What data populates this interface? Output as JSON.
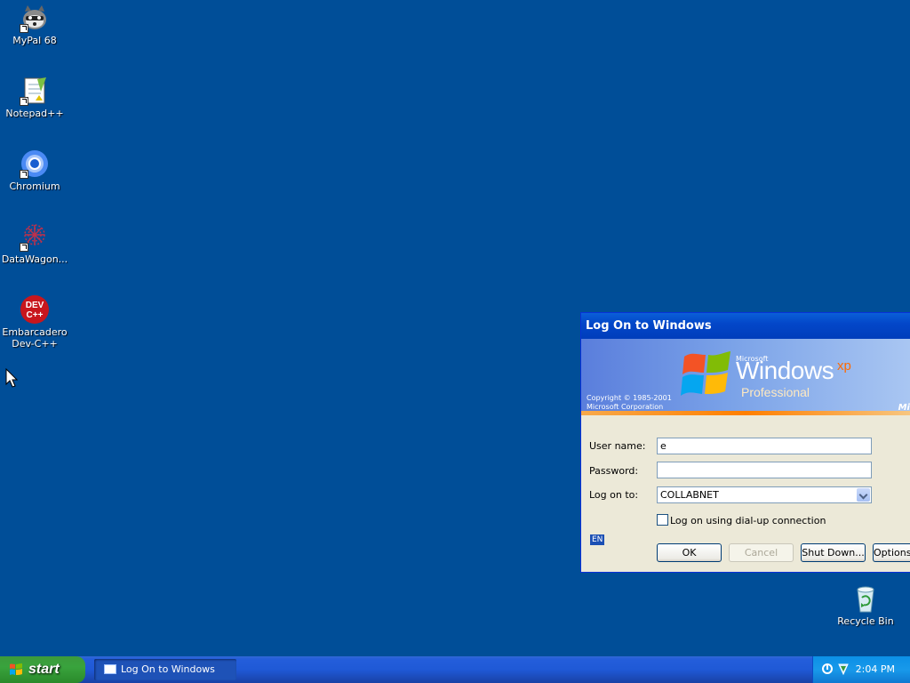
{
  "desktop": {
    "icons": [
      {
        "label": "MyPal 68",
        "icon": "raccoon-icon"
      },
      {
        "label": "Notepad++",
        "icon": "notepad-icon"
      },
      {
        "label": "Chromium",
        "icon": "chromium-icon"
      },
      {
        "label": "DataWagon...",
        "icon": "datawagon-icon"
      },
      {
        "label": "Embarcadero Dev-C++",
        "icon": "devcpp-icon"
      }
    ],
    "recycle_bin": "Recycle Bin"
  },
  "dialog": {
    "title": "Log On to Windows",
    "banner": {
      "copyright_line1": "Copyright © 1985-2001",
      "copyright_line2": "Microsoft Corporation",
      "microsoft": "Microsoft",
      "windows": "Windows",
      "xp": "xp",
      "edition": "Professional",
      "corner": "Mi"
    },
    "username_label": "User name:",
    "username_value": "e",
    "password_label": "Password:",
    "password_value": "",
    "logon_to_label": "Log on to:",
    "logon_to_value": "COLLABNET",
    "dialup_label": "Log on using dial-up connection",
    "dialup_checked": false,
    "language": "EN",
    "buttons": {
      "ok": "OK",
      "cancel": "Cancel",
      "shutdown": "Shut Down...",
      "options": "Options"
    }
  },
  "taskbar": {
    "start": "start",
    "tasks": [
      "Log On to Windows"
    ],
    "clock": "2:04 PM"
  },
  "colors": {
    "desktop": "#004e98",
    "title_bar": "#0347c9",
    "taskbar": "#245edb",
    "start": "#39a33d"
  }
}
